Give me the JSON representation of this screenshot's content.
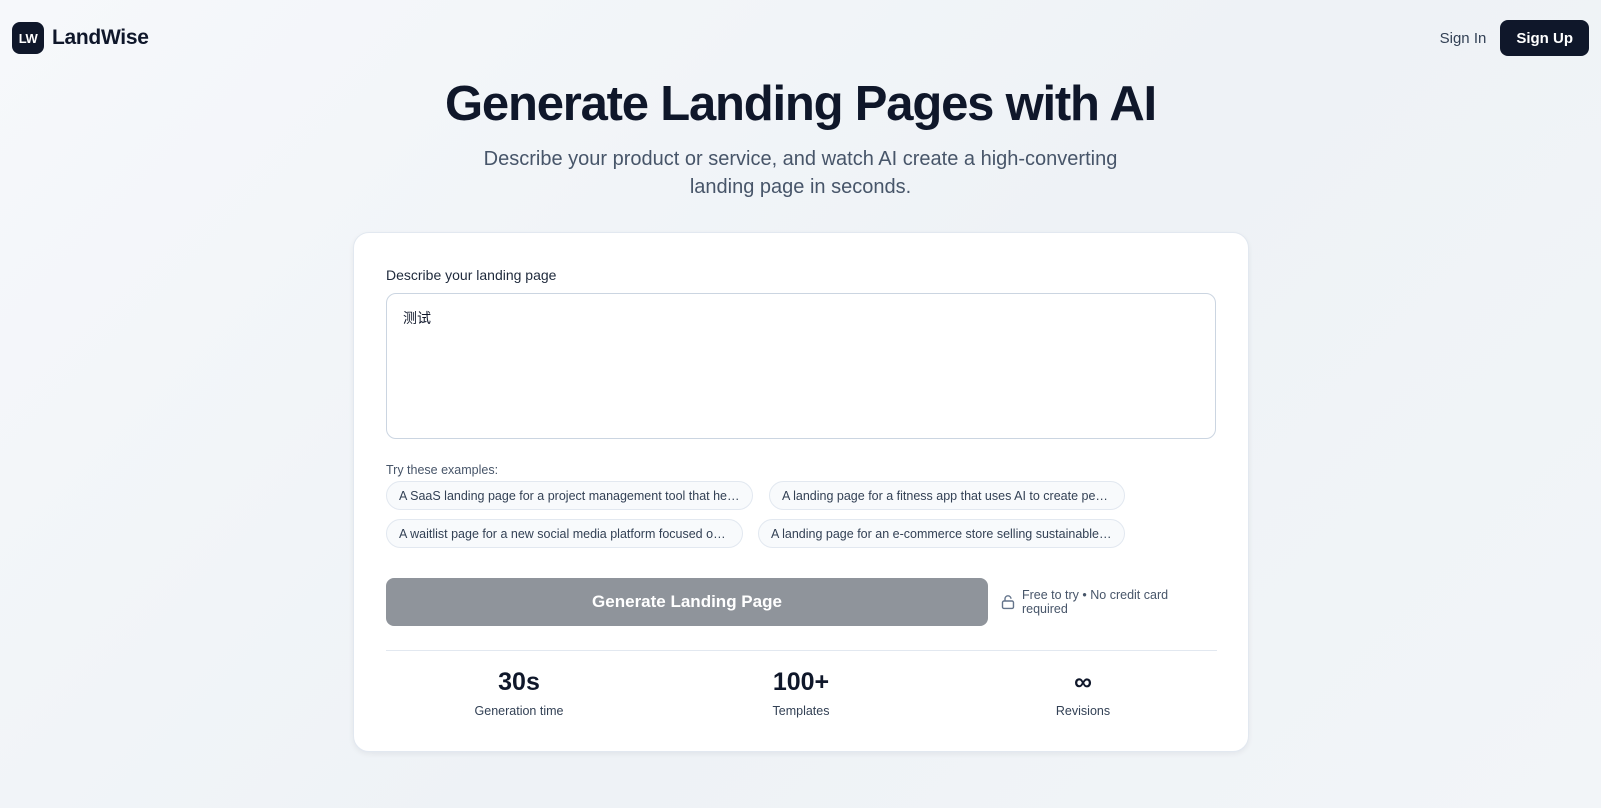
{
  "header": {
    "logo_text": "LW",
    "brand_name": "LandWise",
    "signin_label": "Sign In",
    "signup_label": "Sign Up"
  },
  "hero": {
    "title": "Generate Landing Pages with AI",
    "subtitle": "Describe your product or service, and watch AI create a high-converting landing page in seconds."
  },
  "form": {
    "label": "Describe your landing page",
    "input_value": "测试",
    "examples_label": "Try these examples:",
    "examples": [
      "A SaaS landing page for a project management tool that helps teams collaborate",
      "A landing page for a fitness app that uses AI to create personalized workouts",
      "A waitlist page for a new social media platform focused on privacy",
      "A landing page for an e-commerce store selling sustainable fashion"
    ],
    "generate_label": "Generate Landing Page",
    "free_note": "Free to try • No credit card required"
  },
  "stats": [
    {
      "value": "30s",
      "label": "Generation time"
    },
    {
      "value": "100+",
      "label": "Templates"
    },
    {
      "value": "∞",
      "label": "Revisions"
    }
  ],
  "colors": {
    "primary": "#0f172a",
    "disabled_button": "#8f949b",
    "muted_text": "#475569"
  },
  "icons": {
    "free_note": "lock-icon"
  }
}
